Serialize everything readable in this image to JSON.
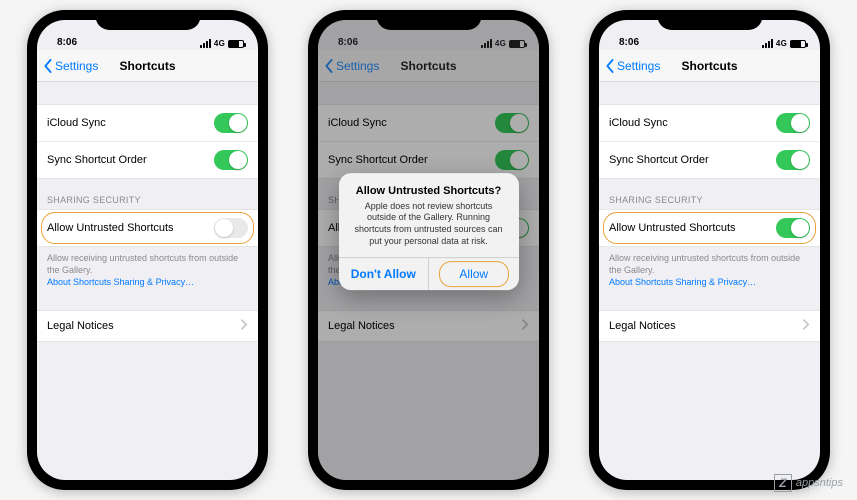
{
  "status": {
    "time": "8:06",
    "net": "4G"
  },
  "nav": {
    "back": "Settings",
    "title": "Shortcuts"
  },
  "rows": {
    "icloud": "iCloud Sync",
    "syncOrder": "Sync Shortcut Order",
    "sectionSecurity": "SHARING SECURITY",
    "allowUntrusted": "Allow Untrusted Shortcuts",
    "footer": "Allow receiving untrusted shortcuts from outside the Gallery.",
    "footerLink": "About Shortcuts Sharing & Privacy…",
    "legal": "Legal Notices"
  },
  "phones": [
    {
      "allowUntrustedOn": false,
      "highlightAllow": true,
      "showAlert": false,
      "dim": false
    },
    {
      "allowUntrustedOn": true,
      "highlightAllow": false,
      "showAlert": true,
      "dim": true
    },
    {
      "allowUntrustedOn": true,
      "highlightAllow": true,
      "showAlert": false,
      "dim": false
    }
  ],
  "alert": {
    "title": "Allow Untrusted Shortcuts?",
    "message": "Apple does not review shortcuts outside of the Gallery. Running shortcuts from untrusted sources can put your personal data at risk.",
    "dontAllow": "Don't Allow",
    "allow": "Allow"
  },
  "colors": {
    "accent": "#007aff",
    "toggleOn": "#34c759",
    "highlight": "#e9a23b"
  },
  "watermark": "appsntips"
}
